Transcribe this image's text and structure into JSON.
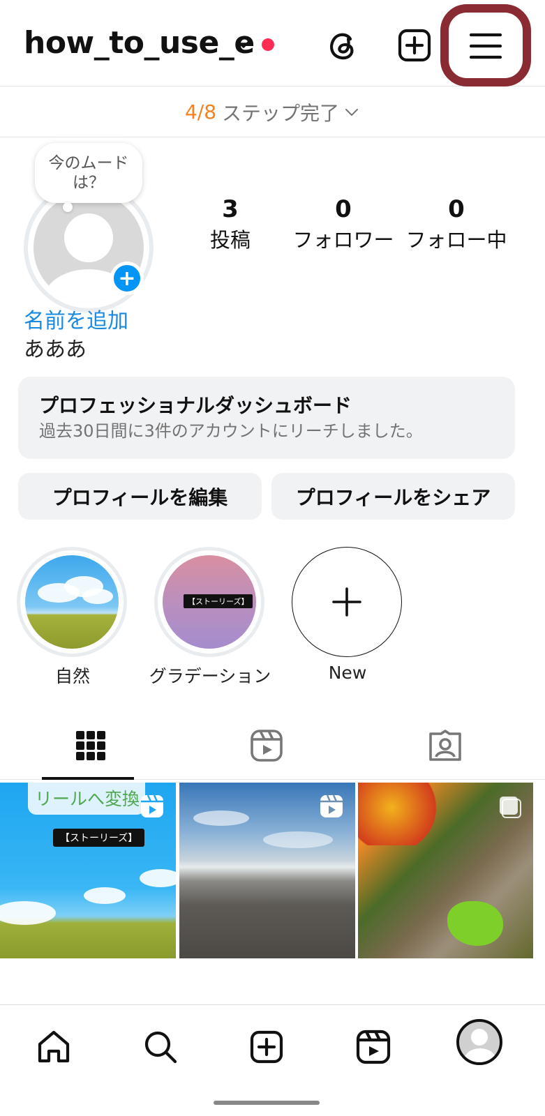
{
  "header": {
    "username": "how_to_use_e",
    "icons": [
      "chevron-down-icon",
      "notification-dot",
      "threads-icon",
      "create-icon",
      "menu-icon"
    ],
    "highlight_color": "#8a2a32"
  },
  "step_bar": {
    "count": "4/8",
    "label": "ステップ完了",
    "count_color": "#f5821f"
  },
  "profile": {
    "mood_bubble": "今のムードは？",
    "add_name": "名前を追加",
    "bio": "あああ",
    "stats": [
      {
        "value": "3",
        "label": "投稿"
      },
      {
        "value": "0",
        "label": "フォロワー"
      },
      {
        "value": "0",
        "label": "フォロー中"
      }
    ]
  },
  "dashboard": {
    "title": "プロフェッショナルダッシュボード",
    "subtitle": "過去30日間に3件のアカウントにリーチしました。"
  },
  "buttons": {
    "edit": "プロフィールを編集",
    "share": "プロフィールをシェア"
  },
  "highlights": [
    {
      "label": "自然",
      "tag": ""
    },
    {
      "label": "グラデーション",
      "tag": "【ストーリーズ】"
    },
    {
      "label": "New",
      "tag": ""
    }
  ],
  "tabs": [
    "grid-icon",
    "reels-icon",
    "tagged-icon"
  ],
  "posts": [
    {
      "overlay": "リールへ変換",
      "tag": "【ストーリーズ】",
      "type": "reel"
    },
    {
      "overlay": "",
      "tag": "",
      "type": "reel"
    },
    {
      "overlay": "",
      "tag": "",
      "type": "post"
    }
  ],
  "bottom_nav": [
    "home-icon",
    "search-icon",
    "create-icon",
    "reels-icon",
    "profile-avatar"
  ],
  "colors": {
    "link": "#1a8ae0",
    "accent_blue": "#0095f6"
  }
}
